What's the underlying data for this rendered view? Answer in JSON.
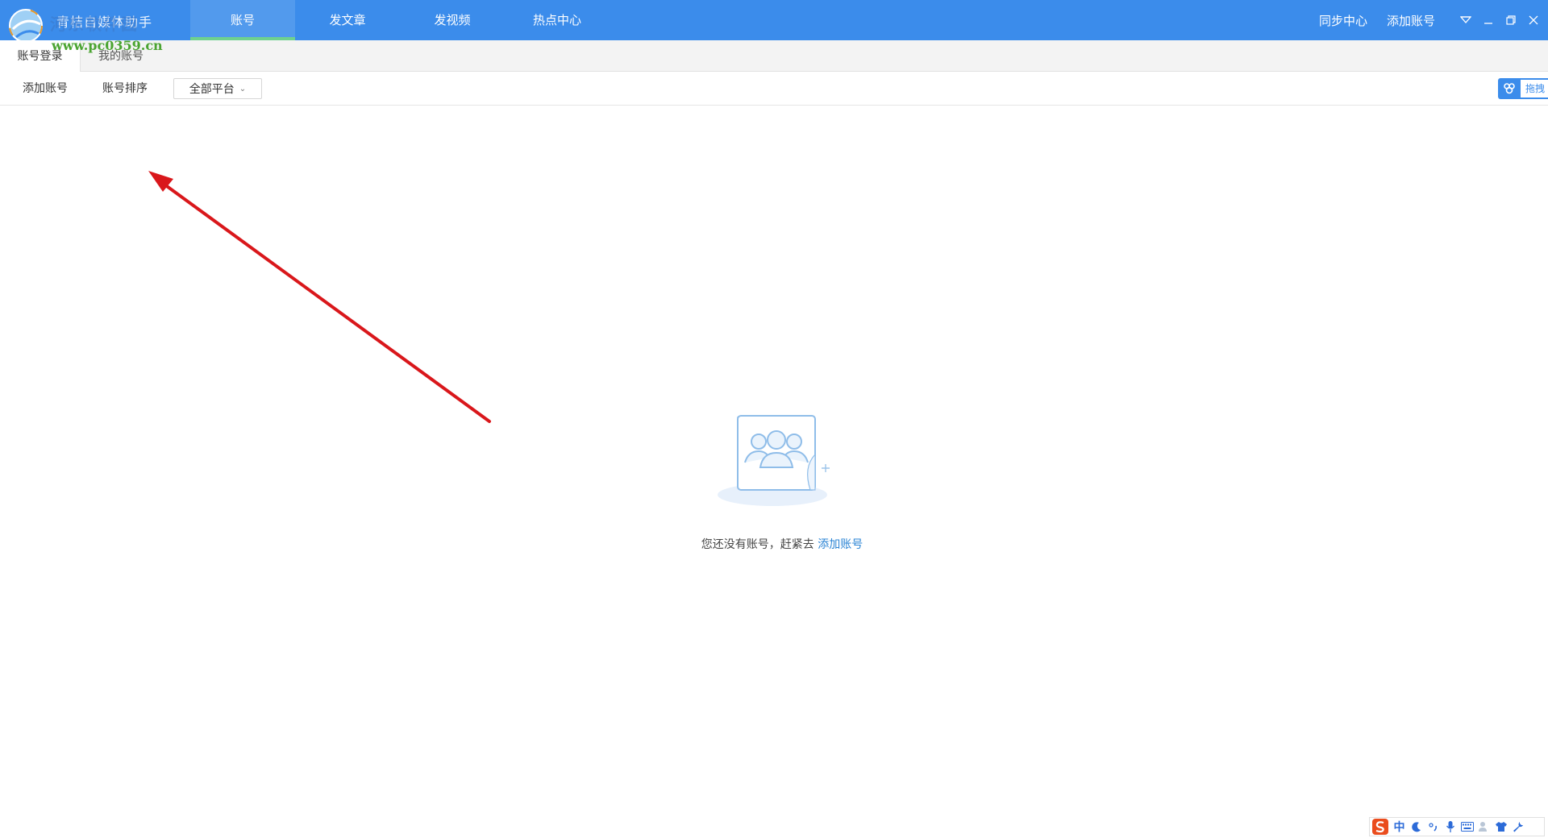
{
  "window": {
    "app_title": "青桔自媒体助手",
    "watermark_text": "河东软件园",
    "watermark_url": "www.pc0359.cn"
  },
  "nav": {
    "tabs": [
      {
        "label": "账号",
        "active": true
      },
      {
        "label": "发文章",
        "active": false
      },
      {
        "label": "发视频",
        "active": false
      },
      {
        "label": "热点中心",
        "active": false
      }
    ]
  },
  "title_actions": {
    "sync_center": "同步中心",
    "add_account": "添加账号"
  },
  "subtabs": {
    "login": "账号登录",
    "mine": "我的账号"
  },
  "toolbar": {
    "add_account": "添加账号",
    "sort_accounts": "账号排序",
    "platform_select": "全部平台",
    "right_widget_label": "拖拽"
  },
  "empty_state": {
    "message": "您还没有账号，赶紧去",
    "link": "添加账号"
  },
  "ime": {
    "mode": "中"
  },
  "colors": {
    "titlebar": "#3b8ceb",
    "active_tab_indicator": "#6ed18f",
    "link": "#2b84d4",
    "annotation_arrow": "#d9171b"
  }
}
